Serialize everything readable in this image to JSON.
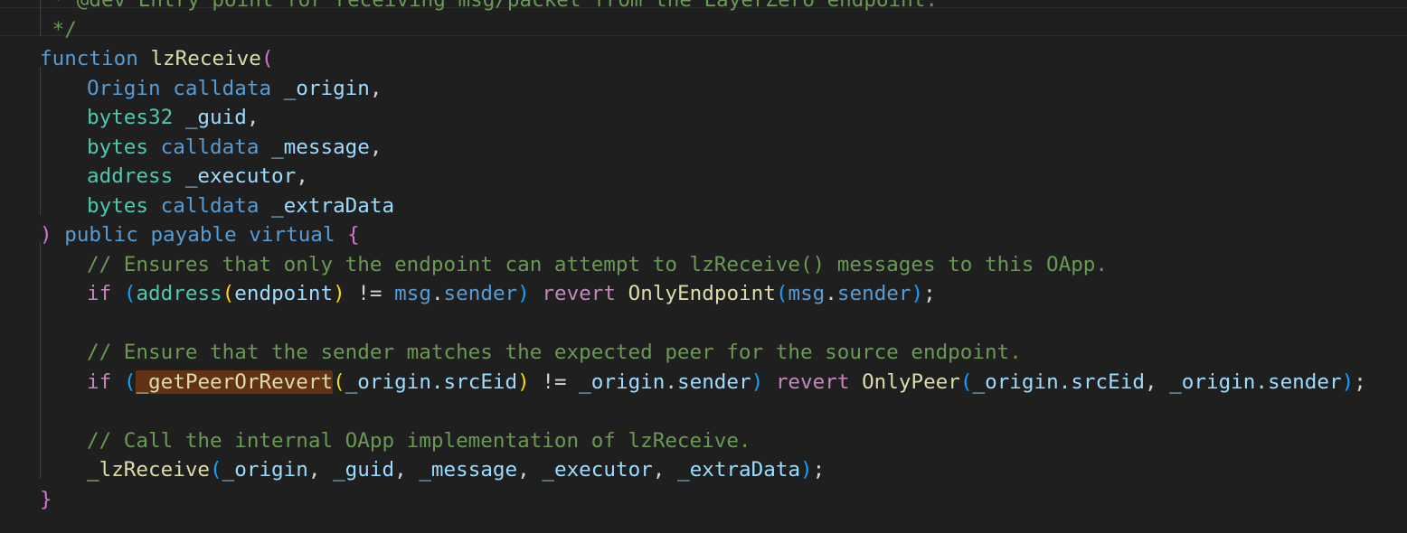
{
  "editor": {
    "language": "solidity",
    "theme_colors": {
      "background": "#1f1f1f",
      "keyword": "#569cd6",
      "control": "#c586c0",
      "type": "#4ec9b0",
      "function": "#dcdcaa",
      "variable": "#9cdcfe",
      "punctuation": "#d4d4d4",
      "comment": "#6a9955",
      "bracket_gold": "#ffd700",
      "bracket_orchid": "#da70d6",
      "bracket_blue": "#179fff",
      "search_highlight": "#613214"
    },
    "lines": [
      {
        "indent": 0,
        "tokens": [
          {
            "t": " * @dev Entry point for receiving msg/packet from the LayerZero endpoint.",
            "c": "comment"
          }
        ]
      },
      {
        "indent": 0,
        "tokens": [
          {
            "t": " */",
            "c": "comment"
          }
        ]
      },
      {
        "indent": 0,
        "tokens": [
          {
            "t": "function",
            "c": "keyword"
          },
          {
            "t": " ",
            "c": "punct"
          },
          {
            "t": "lzReceive",
            "c": "func"
          },
          {
            "t": "(",
            "c": "b2"
          }
        ]
      },
      {
        "indent": 4,
        "tokens": [
          {
            "t": "Origin",
            "c": "keyword"
          },
          {
            "t": " ",
            "c": "punct"
          },
          {
            "t": "calldata",
            "c": "keyword"
          },
          {
            "t": " ",
            "c": "punct"
          },
          {
            "t": "_origin",
            "c": "var"
          },
          {
            "t": ",",
            "c": "punct"
          }
        ]
      },
      {
        "indent": 4,
        "tokens": [
          {
            "t": "bytes32",
            "c": "type"
          },
          {
            "t": " ",
            "c": "punct"
          },
          {
            "t": "_guid",
            "c": "var"
          },
          {
            "t": ",",
            "c": "punct"
          }
        ]
      },
      {
        "indent": 4,
        "tokens": [
          {
            "t": "bytes",
            "c": "type"
          },
          {
            "t": " ",
            "c": "punct"
          },
          {
            "t": "calldata",
            "c": "keyword"
          },
          {
            "t": " ",
            "c": "punct"
          },
          {
            "t": "_message",
            "c": "var"
          },
          {
            "t": ",",
            "c": "punct"
          }
        ]
      },
      {
        "indent": 4,
        "tokens": [
          {
            "t": "address",
            "c": "type"
          },
          {
            "t": " ",
            "c": "punct"
          },
          {
            "t": "_executor",
            "c": "var"
          },
          {
            "t": ",",
            "c": "punct"
          }
        ]
      },
      {
        "indent": 4,
        "tokens": [
          {
            "t": "bytes",
            "c": "type"
          },
          {
            "t": " ",
            "c": "punct"
          },
          {
            "t": "calldata",
            "c": "keyword"
          },
          {
            "t": " ",
            "c": "punct"
          },
          {
            "t": "_extraData",
            "c": "var"
          }
        ]
      },
      {
        "indent": 0,
        "tokens": [
          {
            "t": ")",
            "c": "b2"
          },
          {
            "t": " ",
            "c": "punct"
          },
          {
            "t": "public",
            "c": "keyword"
          },
          {
            "t": " ",
            "c": "punct"
          },
          {
            "t": "payable",
            "c": "keyword"
          },
          {
            "t": " ",
            "c": "punct"
          },
          {
            "t": "virtual",
            "c": "keyword"
          },
          {
            "t": " ",
            "c": "punct"
          },
          {
            "t": "{",
            "c": "b2"
          }
        ]
      },
      {
        "indent": 4,
        "tokens": [
          {
            "t": "// Ensures that only the endpoint can attempt to lzReceive() messages to this OApp.",
            "c": "comment"
          }
        ]
      },
      {
        "indent": 4,
        "tokens": [
          {
            "t": "if",
            "c": "control"
          },
          {
            "t": " ",
            "c": "punct"
          },
          {
            "t": "(",
            "c": "b3"
          },
          {
            "t": "address",
            "c": "type"
          },
          {
            "t": "(",
            "c": "b1"
          },
          {
            "t": "endpoint",
            "c": "var"
          },
          {
            "t": ")",
            "c": "b1"
          },
          {
            "t": " != ",
            "c": "punct"
          },
          {
            "t": "msg",
            "c": "keyword"
          },
          {
            "t": ".",
            "c": "punct"
          },
          {
            "t": "sender",
            "c": "keyword"
          },
          {
            "t": ")",
            "c": "b3"
          },
          {
            "t": " ",
            "c": "punct"
          },
          {
            "t": "revert",
            "c": "control"
          },
          {
            "t": " ",
            "c": "punct"
          },
          {
            "t": "OnlyEndpoint",
            "c": "func"
          },
          {
            "t": "(",
            "c": "b3"
          },
          {
            "t": "msg",
            "c": "keyword"
          },
          {
            "t": ".",
            "c": "punct"
          },
          {
            "t": "sender",
            "c": "keyword"
          },
          {
            "t": ")",
            "c": "b3"
          },
          {
            "t": ";",
            "c": "punct"
          }
        ]
      },
      {
        "indent": 0,
        "tokens": []
      },
      {
        "indent": 4,
        "tokens": [
          {
            "t": "// Ensure that the sender matches the expected peer for the source endpoint.",
            "c": "comment"
          }
        ]
      },
      {
        "indent": 4,
        "tokens": [
          {
            "t": "if",
            "c": "control"
          },
          {
            "t": " ",
            "c": "punct"
          },
          {
            "t": "(",
            "c": "b3"
          },
          {
            "t": "_getPeerOrRevert",
            "c": "func",
            "hl": true
          },
          {
            "t": "(",
            "c": "b1"
          },
          {
            "t": "_origin",
            "c": "var"
          },
          {
            "t": ".srcEid",
            "c": "var"
          },
          {
            "t": ")",
            "c": "b1"
          },
          {
            "t": " != ",
            "c": "punct"
          },
          {
            "t": "_origin",
            "c": "var"
          },
          {
            "t": ".sender",
            "c": "var"
          },
          {
            "t": ")",
            "c": "b3"
          },
          {
            "t": " ",
            "c": "punct"
          },
          {
            "t": "revert",
            "c": "control"
          },
          {
            "t": " ",
            "c": "punct"
          },
          {
            "t": "OnlyPeer",
            "c": "func"
          },
          {
            "t": "(",
            "c": "b3"
          },
          {
            "t": "_origin",
            "c": "var"
          },
          {
            "t": ".srcEid",
            "c": "var"
          },
          {
            "t": ", ",
            "c": "punct"
          },
          {
            "t": "_origin",
            "c": "var"
          },
          {
            "t": ".sender",
            "c": "var"
          },
          {
            "t": ")",
            "c": "b3"
          },
          {
            "t": ";",
            "c": "punct"
          }
        ]
      },
      {
        "indent": 0,
        "tokens": []
      },
      {
        "indent": 4,
        "tokens": [
          {
            "t": "// Call the internal OApp implementation of lzReceive.",
            "c": "comment"
          }
        ]
      },
      {
        "indent": 4,
        "tokens": [
          {
            "t": "_lzReceive",
            "c": "func"
          },
          {
            "t": "(",
            "c": "b3"
          },
          {
            "t": "_origin",
            "c": "var"
          },
          {
            "t": ", ",
            "c": "punct"
          },
          {
            "t": "_guid",
            "c": "var"
          },
          {
            "t": ", ",
            "c": "punct"
          },
          {
            "t": "_message",
            "c": "var"
          },
          {
            "t": ", ",
            "c": "punct"
          },
          {
            "t": "_executor",
            "c": "var"
          },
          {
            "t": ", ",
            "c": "punct"
          },
          {
            "t": "_extraData",
            "c": "var"
          },
          {
            "t": ")",
            "c": "b3"
          },
          {
            "t": ";",
            "c": "punct"
          }
        ]
      },
      {
        "indent": 0,
        "tokens": [
          {
            "t": "}",
            "c": "b2"
          }
        ]
      }
    ]
  }
}
